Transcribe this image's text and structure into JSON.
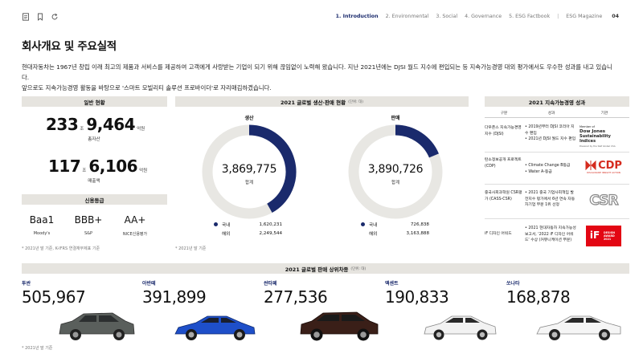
{
  "nav": {
    "items": [
      "1. Introduction",
      "2. Environmental",
      "3. Social",
      "4. Governance",
      "5. ESG Factbook"
    ],
    "magazine": "ESG Magazine",
    "page": "04"
  },
  "title": "회사개요 및 주요실적",
  "intro": {
    "line1": "현대자동차는 1967년 창립 이래 최고의 제품과 서비스를 제공하여 고객에게 사랑받는 기업이 되기 위해 끊임없이 노력해 왔습니다. 지난 2021년에는 DJSI 월드 지수에 편입되는 등 지속가능경영 대외 평가에서도 우수한 성과를 내고 있습니다.",
    "line2": "앞으로도 지속가능경영 활동을 바탕으로 '스마트 모빌리티 솔루션 프로바이더'로 자리매김하겠습니다."
  },
  "general": {
    "header": "일반 현황",
    "assets": {
      "trillion": "233",
      "trillion_unit": "조",
      "billion": "9,464",
      "billion_unit": "억원",
      "label": "총자산"
    },
    "sales": {
      "trillion": "117",
      "trillion_unit": "조",
      "billion": "6,106",
      "billion_unit": "억원",
      "label": "매출액"
    },
    "credit_header": "신용등급",
    "ratings": [
      {
        "value": "Baa1",
        "agency": "Moody's"
      },
      {
        "value": "BBB+",
        "agency": "S&P"
      },
      {
        "value": "AA+",
        "agency": "NICE신용평가"
      }
    ],
    "note": "* 2021년 말 기준, K-IFRS 연결재무제표 기준"
  },
  "production": {
    "header": "2021 글로벌 생산·판매 현황",
    "unit": "(단위: 대)",
    "note": "* 2021년 말 기준",
    "charts": [
      {
        "title": "생산",
        "total": "3,869,775",
        "total_label": "합계",
        "domestic_label": "국내",
        "domestic": "1,620,231",
        "overseas_label": "해외",
        "overseas": "2,249,544",
        "domestic_value": 1620231,
        "overseas_value": 2249544
      },
      {
        "title": "판매",
        "total": "3,890,726",
        "total_label": "합계",
        "domestic_label": "국내",
        "domestic": "726,838",
        "overseas_label": "해외",
        "overseas": "3,163,888",
        "domestic_value": 726838,
        "overseas_value": 3163888
      }
    ],
    "colors": {
      "domestic": "#1a2a6c",
      "overseas": "#e8e7e3"
    }
  },
  "esg": {
    "header": "2021 지속가능경영 성과",
    "columns": [
      "구분",
      "성과",
      "기관"
    ],
    "rows": [
      {
        "category": "다우존스 지속가능경영지수 (DJSI)",
        "results": [
          "• 2019년부터 DJSI 코리아 지수 편입",
          "• 2021년 DJSI 월드 지수 편입"
        ],
        "logo": "DJSI",
        "logo_lines": [
          "Member of",
          "Dow Jones",
          "Sustainability Indices",
          "Powered by the S&P Global CSA"
        ]
      },
      {
        "category": "탄소정보공개 프로젝트 (CDP)",
        "results": [
          "• Climate Change B등급",
          "• Water A-등급"
        ],
        "logo": "CDP",
        "logo_lines": [
          "CDP",
          "DISCLOSURE INSIGHT ACTION"
        ]
      },
      {
        "category": "중국사회과학원 CSR평가 (CASS-CSR)",
        "results": [
          "• 2021 중국 기업사회책임 발전지수 평가에서 6년 연속 자동차기업 부문 1위 선정"
        ],
        "logo": "CSR",
        "logo_lines": [
          "CSR"
        ]
      },
      {
        "category": "iF 디자인 어워드",
        "results": [
          "• 2021 현대자동차 지속가능성 보고서, '2022 iF 디자인 어워드' 수상 (커뮤니케이션 부문)"
        ],
        "logo": "iF",
        "logo_lines": [
          "iF",
          "DESIGN",
          "AWARD",
          "2021"
        ]
      }
    ]
  },
  "top_sellers": {
    "header": "2021 글로벌 판매 상위차종",
    "unit": "(단위: 대)",
    "note": "* 2021년 말 기준",
    "cars": [
      {
        "name": "투싼",
        "value": "505,967",
        "color": "#5a5f5c"
      },
      {
        "name": "아반떼",
        "value": "391,899",
        "color": "#1e4fc9"
      },
      {
        "name": "싼타페",
        "value": "277,536",
        "color": "#3a1f18"
      },
      {
        "name": "액센트",
        "value": "190,833",
        "color": "#f2f2f2"
      },
      {
        "name": "쏘나타",
        "value": "168,878",
        "color": "#f5f5f5"
      }
    ]
  }
}
